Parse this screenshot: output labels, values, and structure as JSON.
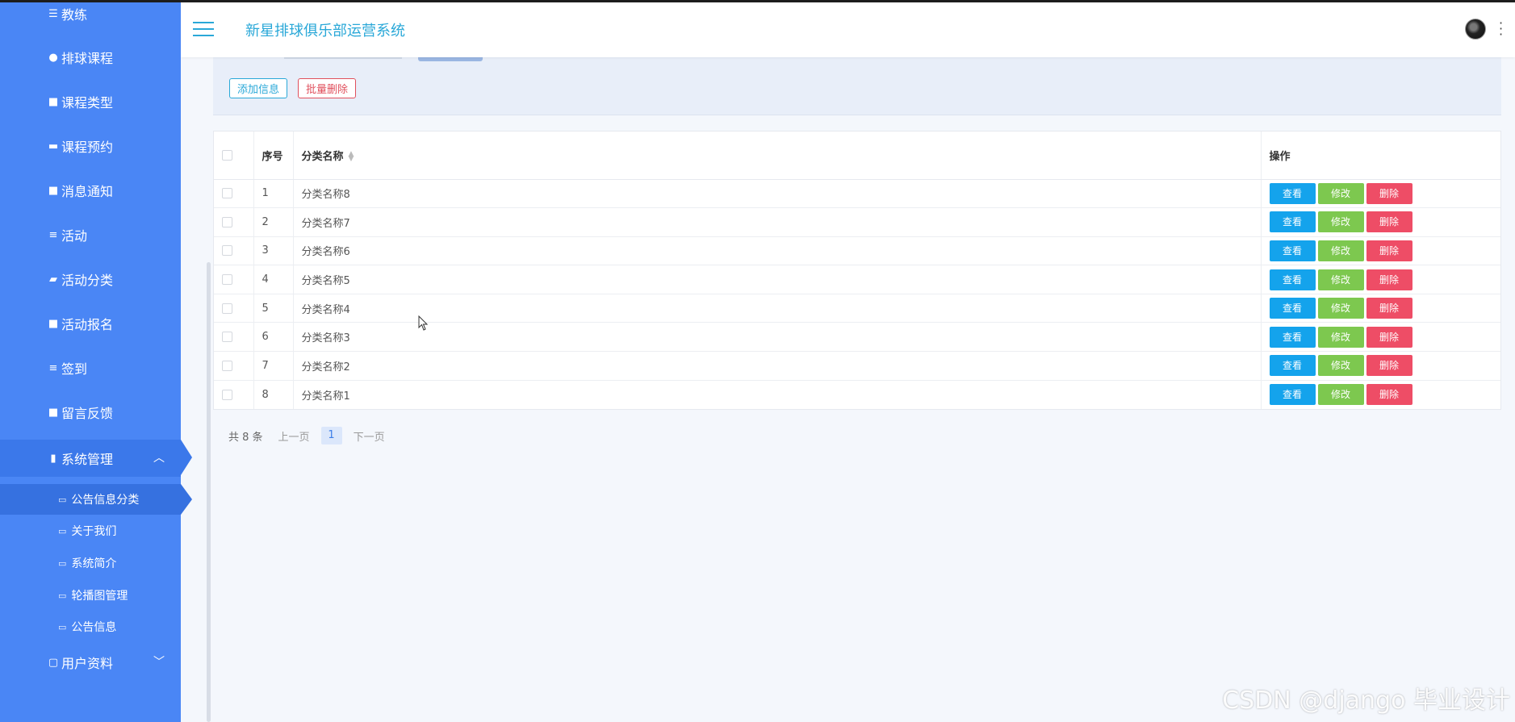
{
  "header": {
    "title": "新星排球俱乐部运营系统"
  },
  "sidebar": {
    "items": [
      {
        "label": "教练",
        "icon": "sliders-icon"
      },
      {
        "label": "排球课程",
        "icon": "user-icon"
      },
      {
        "label": "课程类型",
        "icon": "grid-icon"
      },
      {
        "label": "课程预约",
        "icon": "card-icon"
      },
      {
        "label": "消息通知",
        "icon": "grid-icon"
      },
      {
        "label": "活动",
        "icon": "list-icon"
      },
      {
        "label": "活动分类",
        "icon": "ticket-icon"
      },
      {
        "label": "活动报名",
        "icon": "grid-icon"
      },
      {
        "label": "签到",
        "icon": "list-icon"
      },
      {
        "label": "留言反馈",
        "icon": "grid-icon"
      },
      {
        "label": "系统管理",
        "icon": "clipboard-icon"
      }
    ],
    "submenu": [
      {
        "label": "公告信息分类"
      },
      {
        "label": "关于我们"
      },
      {
        "label": "系统简介"
      },
      {
        "label": "轮播图管理"
      },
      {
        "label": "公告信息"
      }
    ],
    "user_profile": "用户资料"
  },
  "toolbar": {
    "add_label": "添加信息",
    "batch_delete_label": "批量删除"
  },
  "table": {
    "columns": [
      "序号",
      "分类名称",
      "操作"
    ],
    "rows": [
      {
        "index": "1",
        "name": "分类名称8"
      },
      {
        "index": "2",
        "name": "分类名称7"
      },
      {
        "index": "3",
        "name": "分类名称6"
      },
      {
        "index": "4",
        "name": "分类名称5"
      },
      {
        "index": "5",
        "name": "分类名称4"
      },
      {
        "index": "6",
        "name": "分类名称3"
      },
      {
        "index": "7",
        "name": "分类名称2"
      },
      {
        "index": "8",
        "name": "分类名称1"
      }
    ],
    "actions": {
      "view": "查看",
      "edit": "修改",
      "delete": "删除"
    }
  },
  "pagination": {
    "total": "共 8 条",
    "prev": "上一页",
    "current": "1",
    "next": "下一页"
  },
  "watermark": "CSDN @django 毕业设计",
  "colors": {
    "sidebar": "#4a86f5",
    "accent": "#2aa8d8",
    "view": "#14a3ec",
    "edit": "#7dc84f",
    "delete": "#ee4d66"
  }
}
